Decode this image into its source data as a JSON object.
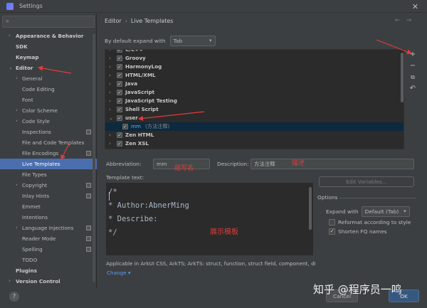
{
  "window": {
    "title": "Settings",
    "close_glyph": "✕"
  },
  "sidebar": {
    "items": [
      {
        "label": "Appearance & Behavior",
        "expanded": false,
        "bold": true
      },
      {
        "label": "SDK",
        "bold": true
      },
      {
        "label": "Keymap",
        "bold": true
      },
      {
        "label": "Editor",
        "expanded": true,
        "bold": true
      },
      {
        "label": "General",
        "expanded": false
      },
      {
        "label": "Code Editing"
      },
      {
        "label": "Font"
      },
      {
        "label": "Color Scheme",
        "expanded": false
      },
      {
        "label": "Code Style",
        "expanded": false
      },
      {
        "label": "Inspections",
        "badge": true
      },
      {
        "label": "File and Code Templates"
      },
      {
        "label": "File Encodings",
        "badge": true
      },
      {
        "label": "Live Templates",
        "selected": true
      },
      {
        "label": "File Types"
      },
      {
        "label": "Copyright",
        "expanded": false,
        "badge": true
      },
      {
        "label": "Inlay Hints",
        "badge": true
      },
      {
        "label": "Emmet"
      },
      {
        "label": "Intentions"
      },
      {
        "label": "Language Injections",
        "expanded": false,
        "badge": true
      },
      {
        "label": "Reader Mode",
        "badge": true
      },
      {
        "label": "Spelling",
        "badge": true
      },
      {
        "label": "TODO"
      },
      {
        "label": "Plugins",
        "bold": true
      },
      {
        "label": "Version Control",
        "expanded": false,
        "bold": true
      }
    ]
  },
  "breadcrumb": {
    "parent": "Editor",
    "separator": "›",
    "current": "Live Templates"
  },
  "expand": {
    "label": "By default expand with",
    "value": "Tab"
  },
  "templates": [
    {
      "name": "C/C++",
      "checked": true
    },
    {
      "name": "Groovy",
      "checked": true
    },
    {
      "name": "HarmonyLog",
      "checked": true
    },
    {
      "name": "HTML/XML",
      "checked": true
    },
    {
      "name": "Java",
      "checked": true
    },
    {
      "name": "JavaScript",
      "checked": true
    },
    {
      "name": "JavaScript Testing",
      "checked": true
    },
    {
      "name": "Shell Script",
      "checked": true
    },
    {
      "name": "user",
      "checked": true,
      "expanded": true
    },
    {
      "name": "mm",
      "desc": "(方法注释)",
      "checked": true,
      "child": true,
      "selected": true
    },
    {
      "name": "Zen HTML",
      "checked": true
    },
    {
      "name": "Zen XSL",
      "checked": true
    }
  ],
  "toolbar": {
    "add": "+",
    "remove": "−",
    "copy": "⧉",
    "restore": "↶"
  },
  "abbreviation": {
    "label": "Abbreviation:",
    "value": "mm"
  },
  "description": {
    "label": "Description:",
    "value": "方法注释"
  },
  "template_text": {
    "label": "Template text:",
    "lines": [
      "/*",
      "* Author:AbnerMing",
      "* Describe:",
      "*/"
    ]
  },
  "edit_variables": "Edit Variables...",
  "options": {
    "title": "Options",
    "expand_label": "Expand with",
    "expand_value": "Default (Tab)",
    "reformat": {
      "label": "Reformat according to style",
      "checked": false
    },
    "shorten": {
      "label": "Shorten FQ names",
      "checked": true
    }
  },
  "applicable": "Applicable in ArkUI CSS, ArkTS; ArkTS: struct, function, struct field, component, dial",
  "change": "Change",
  "buttons": {
    "cancel": "Cancel",
    "ok": "OK"
  },
  "help": "?",
  "annotations": {
    "abbr": "缩写名",
    "desc": "描述",
    "template": "展示模板"
  },
  "watermark": "知乎 @程序员一鸣",
  "colors": {
    "accent": "#4b6eaf",
    "annotation": "#e33b3b",
    "link": "#589df6"
  }
}
